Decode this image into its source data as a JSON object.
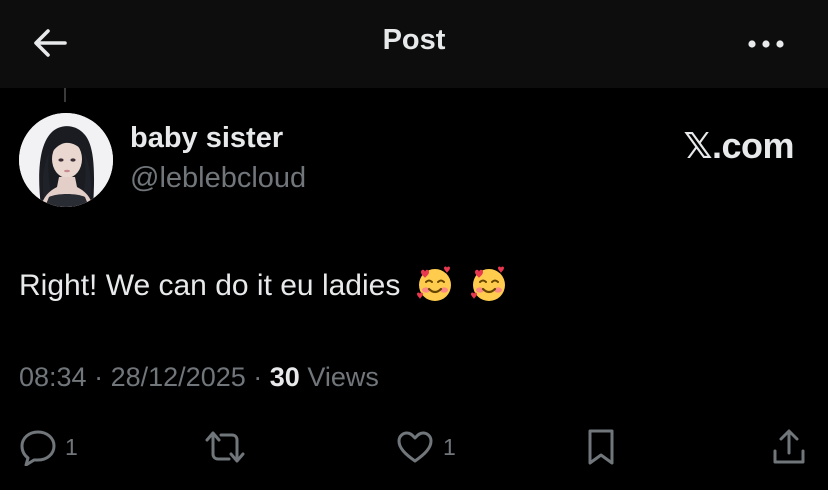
{
  "header": {
    "title": "Post",
    "back_icon": "arrow-left-icon",
    "more_icon": "more-horizontal-icon"
  },
  "author": {
    "display_name": "baby sister",
    "handle": "@leblebcloud",
    "avatar_icon": "user-avatar"
  },
  "site_badge": "𝕏.com",
  "post": {
    "text": "Right! We can do it eu ladies",
    "emojis": [
      "smiling-face-with-hearts",
      "smiling-face-with-hearts"
    ]
  },
  "meta": {
    "time": "08:34",
    "separator": "·",
    "date": "28/12/2025",
    "views_count": "30",
    "views_label": "Views"
  },
  "actions": {
    "reply_count": "1",
    "repost_count": "",
    "like_count": "1"
  },
  "colors": {
    "background": "#000000",
    "header_bg": "#0d0d0d",
    "text_primary": "#e7e9ea",
    "text_secondary": "#71767b"
  }
}
